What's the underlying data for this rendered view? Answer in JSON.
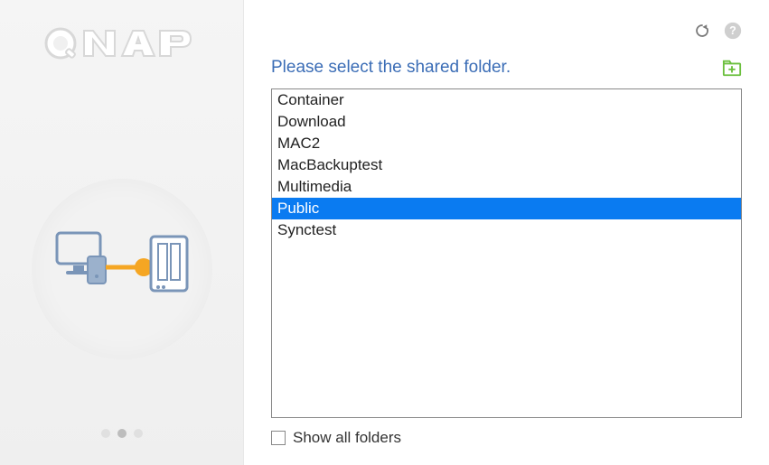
{
  "brand": "QNAP",
  "instruction": "Please select the shared folder.",
  "folders": [
    {
      "name": "Container",
      "selected": false
    },
    {
      "name": "Download",
      "selected": false
    },
    {
      "name": "MAC2",
      "selected": false
    },
    {
      "name": "MacBackuptest",
      "selected": false
    },
    {
      "name": "Multimedia",
      "selected": false
    },
    {
      "name": "Public",
      "selected": true
    },
    {
      "name": "Synctest",
      "selected": false
    }
  ],
  "showAllLabel": "Show all folders",
  "showAllChecked": false,
  "colors": {
    "accent": "#0a7bf1",
    "link": "#3b6db6",
    "newFolder": "#6bbf3d"
  },
  "pager": {
    "count": 3,
    "active": 1
  }
}
